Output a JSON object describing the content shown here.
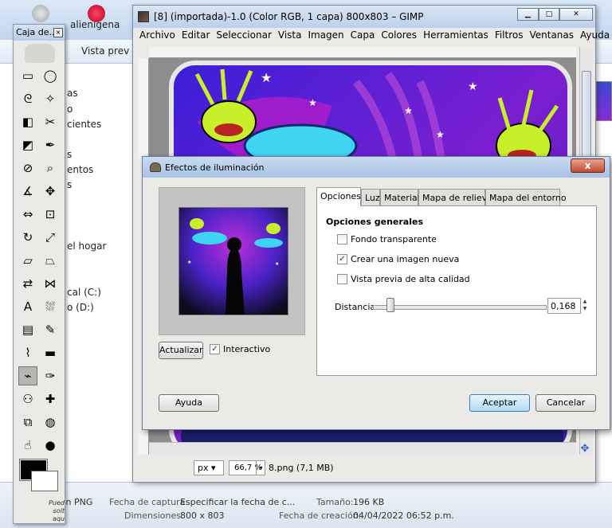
{
  "explorer": {
    "path_label": "alienigena",
    "view_label": "Vista prev",
    "side_items": [
      "as",
      "o",
      "cientes",
      "s",
      "entos",
      "s",
      "el hogar",
      "cal (C:)",
      "o (D:)"
    ],
    "details": {
      "type": "agen PNG",
      "capture_key": "Fecha de captura:",
      "capture_value": "Especificar la fecha de c...",
      "dims_key": "Dimensiones:",
      "dims_value": "800 x 803",
      "size_key": "Tamaño:",
      "size_value": "196 KB",
      "created_key": "Fecha de creación:",
      "created_value": "04/04/2022 06:52 p.m."
    }
  },
  "toolbox": {
    "title": "Caja de...",
    "close_glyph": "×",
    "hint_lines": [
      "Pued",
      "solt",
      "aqu"
    ],
    "tools": [
      "rect-select-icon",
      "ellipse-select-icon",
      "lasso-icon",
      "fuzzy-select-icon",
      "color-select-icon",
      "scissors-icon",
      "foreground-select-icon",
      "paths-icon",
      "color-picker-icon",
      "zoom-icon",
      "measure-icon",
      "move-icon",
      "align-icon",
      "crop-icon",
      "rotate-icon",
      "scale-icon",
      "shear-icon",
      "perspective-icon",
      "flip-icon",
      "cage-icon",
      "text-icon",
      "bucket-fill-icon",
      "blend-icon",
      "pencil-icon",
      "paintbrush-icon",
      "eraser-icon",
      "airbrush-icon",
      "ink-icon",
      "clone-icon",
      "heal-icon",
      "perspective-clone-icon",
      "blur-icon",
      "smudge-icon",
      "dodge-icon"
    ],
    "tool_glyphs": [
      "▭",
      "◯",
      "ᘓ",
      "✧",
      "◧",
      "✂",
      "◩",
      "✒",
      "⊘",
      "⌕",
      "∡",
      "✥",
      "⇔",
      "⊡",
      "↻",
      "⤢",
      "▱",
      "⏢",
      "⇄",
      "⋈",
      "A",
      "⛆",
      "▤",
      "✎",
      "⌇",
      "▬",
      "⌁",
      "✑",
      "⚇",
      "✚",
      "⧉",
      "◍",
      "☝",
      "●"
    ],
    "active_index": 26
  },
  "gimp": {
    "title": "[8] (importada)-1.0 (Color RGB, 1 capa) 800x803 – GIMP",
    "window_buttons": [
      "▁",
      "□",
      "✕"
    ],
    "menu": [
      "Archivo",
      "Editar",
      "Seleccionar",
      "Vista",
      "Imagen",
      "Capa",
      "Colores",
      "Herramientas",
      "Filtros",
      "Ventanas",
      "Ayuda"
    ],
    "unit": "px",
    "zoom": "66,7 %",
    "status_text": "8.png (7,1 MB)"
  },
  "dialog": {
    "title": "Efectos de iluminación",
    "close_label": "x",
    "update_button": "Actualizar",
    "interactive_label": "Interactivo",
    "tabs": [
      "Opciones",
      "Luz",
      "Material",
      "Mapa de relieve",
      "Mapa del entorno"
    ],
    "active_tab": "Opciones",
    "section_title": "Opciones generales",
    "options": [
      {
        "label": "Fondo transparente",
        "checked": false
      },
      {
        "label": "Crear una imagen nueva",
        "checked": true
      },
      {
        "label": "Vista previa de alta calidad",
        "checked": false
      }
    ],
    "distance_label": "Distancia:",
    "distance_value": "0,168",
    "help_button": "Ayuda",
    "ok_button": "Aceptar",
    "cancel_button": "Cancelar"
  },
  "colors": {
    "accent": "#3c7fb1",
    "image_purple": "#6d1fc7",
    "image_blue": "#2d3ee0",
    "alien_green": "#c8f02a",
    "cyan": "#3fd4f2"
  }
}
